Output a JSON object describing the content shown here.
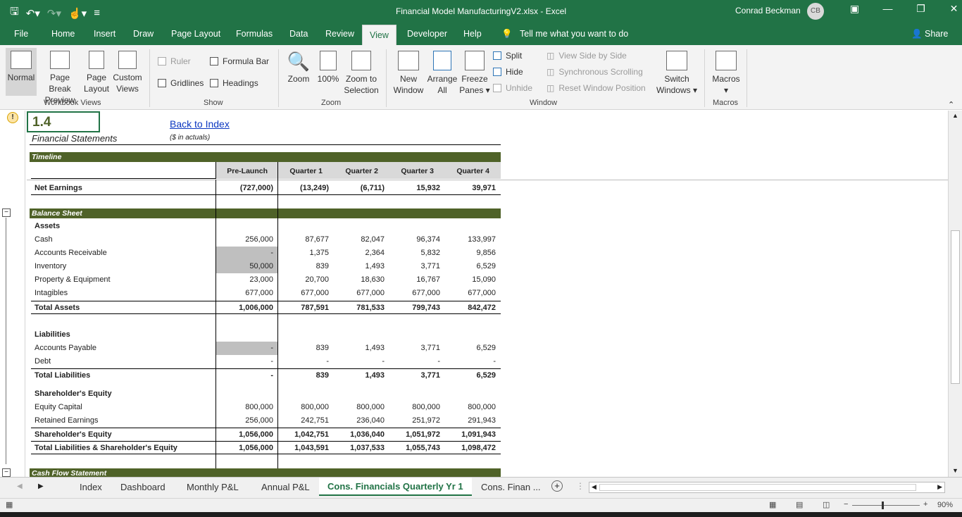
{
  "window": {
    "title": "Financial Model ManufacturingV2.xlsx  -  Excel",
    "user": "Conrad Beckman",
    "initials": "CB"
  },
  "menu": {
    "file": "File",
    "home": "Home",
    "insert": "Insert",
    "draw": "Draw",
    "page_layout": "Page Layout",
    "formulas": "Formulas",
    "data": "Data",
    "review": "Review",
    "view": "View",
    "developer": "Developer",
    "help": "Help",
    "tell_me": "Tell me what you want to do",
    "share": "Share"
  },
  "ribbon": {
    "normal": "Normal",
    "page_break_preview_1": "Page Break",
    "page_break_preview_2": "Preview",
    "page_layout_1": "Page",
    "page_layout_2": "Layout",
    "custom_views_1": "Custom",
    "custom_views_2": "Views",
    "group_workbook_views": "Workbook Views",
    "ruler": "Ruler",
    "formula_bar": "Formula Bar",
    "gridlines": "Gridlines",
    "headings": "Headings",
    "group_show": "Show",
    "zoom": "Zoom",
    "zoom100": "100%",
    "zoom_sel_1": "Zoom to",
    "zoom_sel_2": "Selection",
    "group_zoom": "Zoom",
    "new_window_1": "New",
    "new_window_2": "Window",
    "arrange_1": "Arrange",
    "arrange_2": "All",
    "freeze_1": "Freeze",
    "freeze_2": "Panes ▾",
    "split": "Split",
    "hide": "Hide",
    "unhide": "Unhide",
    "view_side": "View Side by Side",
    "sync_scroll": "Synchronous Scrolling",
    "reset_pos": "Reset Window Position",
    "switch_1": "Switch",
    "switch_2": "Windows ▾",
    "group_window": "Window",
    "macros": "Macros",
    "group_macros": "Macros"
  },
  "sheet": {
    "cell_ref": "1.4",
    "subtitle": "Financial Statements",
    "back_link": "Back to Index",
    "units": "($ in actuals)",
    "timeline_label": "Timeline",
    "columns": [
      "Pre-Launch",
      "Quarter 1",
      "Quarter 2",
      "Quarter 3",
      "Quarter 4"
    ],
    "net_earnings": {
      "label": "Net Earnings",
      "values": [
        "(727,000)",
        "(13,249)",
        "(6,711)",
        "15,932",
        "39,971"
      ]
    },
    "balance_sheet_label": "Balance Sheet",
    "assets_label": "Assets",
    "assets": [
      {
        "label": "Cash",
        "values": [
          "256,000",
          "87,677",
          "82,047",
          "96,374",
          "133,997"
        ]
      },
      {
        "label": "Accounts Receivable",
        "values": [
          "-",
          "1,375",
          "2,364",
          "5,832",
          "9,856"
        ]
      },
      {
        "label": "Inventory",
        "values": [
          "50,000",
          "839",
          "1,493",
          "3,771",
          "6,529"
        ]
      },
      {
        "label": "Property & Equipment",
        "values": [
          "23,000",
          "20,700",
          "18,630",
          "16,767",
          "15,090"
        ]
      },
      {
        "label": "Intagibles",
        "values": [
          "677,000",
          "677,000",
          "677,000",
          "677,000",
          "677,000"
        ]
      }
    ],
    "total_assets": {
      "label": "Total Assets",
      "values": [
        "1,006,000",
        "787,591",
        "781,533",
        "799,743",
        "842,472"
      ]
    },
    "liabilities_label": "Liabilities",
    "liabilities": [
      {
        "label": "Accounts Payable",
        "values": [
          "-",
          "839",
          "1,493",
          "3,771",
          "6,529"
        ]
      },
      {
        "label": "Debt",
        "values": [
          "-",
          "-",
          "-",
          "-",
          "-"
        ]
      }
    ],
    "total_liabilities": {
      "label": "Total Liabilities",
      "values": [
        "-",
        "839",
        "1,493",
        "3,771",
        "6,529"
      ]
    },
    "equity_label": "Shareholder's Equity",
    "equity": [
      {
        "label": "Equity Capital",
        "values": [
          "800,000",
          "800,000",
          "800,000",
          "800,000",
          "800,000"
        ]
      },
      {
        "label": "Retained Earnings",
        "values": [
          "256,000",
          "242,751",
          "236,040",
          "251,972",
          "291,943"
        ]
      }
    ],
    "total_equity": {
      "label": "Shareholder's Equity",
      "values": [
        "1,056,000",
        "1,042,751",
        "1,036,040",
        "1,051,972",
        "1,091,943"
      ]
    },
    "total_le": {
      "label": "Total Liabilities & Shareholder's Equity",
      "values": [
        "1,056,000",
        "1,043,591",
        "1,037,533",
        "1,055,743",
        "1,098,472"
      ]
    },
    "cash_flow_label": "Cash Flow Statement"
  },
  "sheet_tabs": [
    "Index",
    "Dashboard",
    "Monthly P&L",
    "Annual P&L",
    "Cons. Financials Quarterly Yr 1",
    "Cons. Finan ..."
  ],
  "status": {
    "zoom": "90%"
  }
}
